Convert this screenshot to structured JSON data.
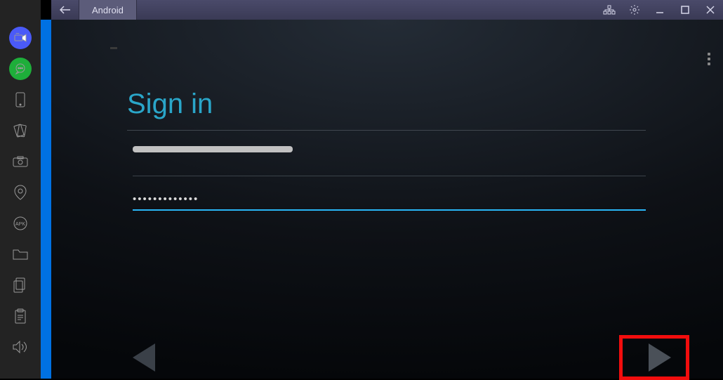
{
  "titlebar": {
    "tab_label": "Android"
  },
  "sidebar": {
    "items": [
      {
        "name": "camera-app-icon"
      },
      {
        "name": "chat-app-icon"
      },
      {
        "name": "device-icon"
      },
      {
        "name": "rotate-icon"
      },
      {
        "name": "screenshot-icon"
      },
      {
        "name": "location-icon"
      },
      {
        "name": "apk-icon"
      },
      {
        "name": "folder-icon"
      },
      {
        "name": "copy-icon"
      },
      {
        "name": "paste-icon"
      },
      {
        "name": "volume-icon"
      }
    ]
  },
  "signin": {
    "heading": "Sign in",
    "email_value": "",
    "password_value": "•••••••••••••"
  }
}
